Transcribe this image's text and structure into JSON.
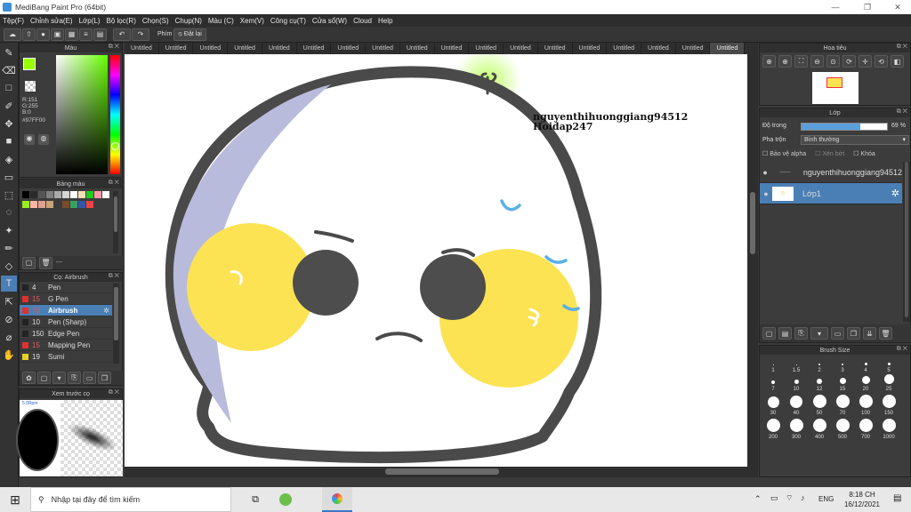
{
  "window": {
    "title": "MediBang Paint Pro (64bit)"
  },
  "menu": [
    "Tệp(F)",
    "Chỉnh sửa(E)",
    "Lớp(L)",
    "Bộ lọc(R)",
    "Chọn(S)",
    "Chụp(N)",
    "Màu (C)",
    "Xem(V)",
    "Công cụ(T)",
    "Cửa sổ(W)",
    "Cloud",
    "Help"
  ],
  "toolbar": {
    "snap_label": "Phím",
    "reset_label": "Đặt lại"
  },
  "color_panel": {
    "title": "Màu",
    "r": "R:151",
    "g": "G:255",
    "b": "B:0",
    "hex": "#97FF00",
    "fg_color": "#97ff00",
    "bg_color": "#000000"
  },
  "palette_panel": {
    "title": "Bảng màu",
    "empty_label": "---",
    "swatches": [
      "#000000",
      "#2a2a2a",
      "#555555",
      "#808080",
      "#aaaaaa",
      "#d4d4d4",
      "#ffffff",
      "#f5deb3",
      "#22cc22",
      "#ff99aa",
      "#ffffff",
      "#99ee22",
      "#ffb6a0",
      "#e0a090",
      "#c9a27a",
      "#3a3a3a",
      "#7a4a2a",
      "#3aa060",
      "#3355aa",
      "#ee4444"
    ]
  },
  "brush_panel": {
    "title": "Cọ: Airbrush",
    "brushes": [
      {
        "size": "4",
        "name": "Pen",
        "color": "#222222"
      },
      {
        "size": "15",
        "name": "G Pen",
        "color": "#e03030"
      },
      {
        "size": "70",
        "name": "Airbrush",
        "color": "#e03030"
      },
      {
        "size": "10",
        "name": "Pen (Sharp)",
        "color": "#222222"
      },
      {
        "size": "150",
        "name": "Edge Pen",
        "color": "#222222"
      },
      {
        "size": "15",
        "name": "Mapping Pen",
        "color": "#e03030"
      },
      {
        "size": "19",
        "name": "Sumi",
        "color": "#e8d020"
      }
    ],
    "selected_index": 2
  },
  "preview_panel": {
    "title": "Xem trước cọ",
    "label": "5.0Rpm"
  },
  "tabs": [
    "Untitled",
    "Untitled",
    "Untitled",
    "Untitled",
    "Untitled",
    "Untitled",
    "Untitled",
    "Untitled",
    "Untitled",
    "Untitled",
    "Untitled",
    "Untitled",
    "Untitled",
    "Untitled",
    "Untitled",
    "Untitled",
    "Untitled",
    "Untitled"
  ],
  "active_tab_index": 17,
  "canvas": {
    "watermark_line1": "nguyenthihuonggiang94512",
    "watermark_line2": "Hoidap247"
  },
  "navigator_panel": {
    "title": "Hoa tiêu"
  },
  "layer_panel": {
    "title": "Lớp",
    "opacity_label": "Độ trong",
    "opacity_value": "69 %",
    "opacity_fraction": 0.69,
    "blend_label": "Pha trộn",
    "blend_value": "Bình thường",
    "protect_alpha": "Bảo vệ alpha",
    "clip": "Xén bớt",
    "lock": "Khóa",
    "layers": [
      {
        "name": "nguyenthihuonggiang94512",
        "selected": false
      },
      {
        "name": "Lớp1",
        "selected": true
      }
    ]
  },
  "brush_size_panel": {
    "title": "Brush Size",
    "sizes": [
      "1",
      "1.5",
      "2",
      "3",
      "4",
      "5",
      "7",
      "10",
      "12",
      "15",
      "20",
      "25",
      "30",
      "40",
      "50",
      "70",
      "100",
      "150",
      "200",
      "300",
      "400",
      "500",
      "700",
      "1000"
    ]
  },
  "taskbar": {
    "search_placeholder": "Nhập tại đây để tìm kiếm",
    "lang": "ENG",
    "time": "8:18 CH",
    "date": "16/12/2021"
  }
}
